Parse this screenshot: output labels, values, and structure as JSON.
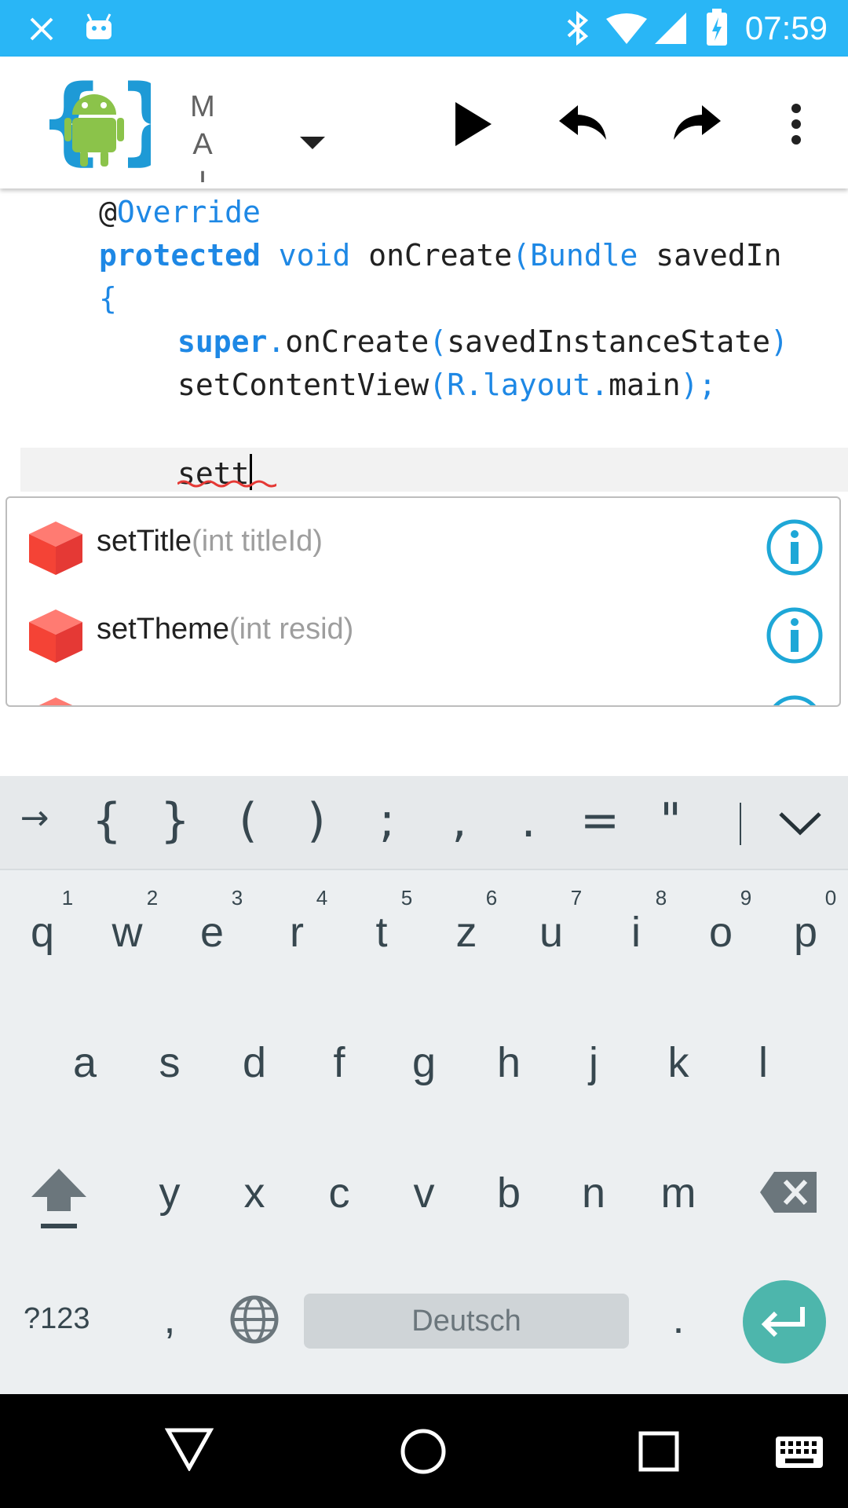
{
  "status_bar": {
    "time": "07:59"
  },
  "app_bar": {
    "title_letters": [
      "M",
      "A",
      "I"
    ],
    "icons": [
      "app-logo-icon",
      "dropdown-icon",
      "run-icon",
      "undo-icon",
      "redo-icon",
      "overflow-menu-icon"
    ]
  },
  "editor": {
    "lines": {
      "annotation_at": "@",
      "annotation_name": "Override",
      "l2_protected": "protected",
      "l2_void": "void",
      "l2_method": "onCreate",
      "l2_open": "(",
      "l2_type": "Bundle",
      "l2_param": "savedIn",
      "l3_brace": "{",
      "l4_super": "super",
      "l4_dot": ".",
      "l4_call": "onCreate",
      "l4_open": "(",
      "l4_arg": "savedInstanceState",
      "l4_close": ")",
      "l5_call": "setContentView",
      "l5_open": "(",
      "l5_r": "R",
      "l5_dot1": ".",
      "l5_layout": "layout",
      "l5_dot2": ".",
      "l5_main": "main",
      "l5_close": ");",
      "current": "sett"
    }
  },
  "suggestions": [
    {
      "name": "setTitle",
      "args": "(int titleId)"
    },
    {
      "name": "setTheme",
      "args": "(int resid)"
    }
  ],
  "symbol_row": {
    "tab": "→",
    "keys": [
      "{",
      "}",
      "(",
      ")",
      ";",
      ",",
      ".",
      "=",
      "\""
    ]
  },
  "keyboard": {
    "row1": [
      "q",
      "w",
      "e",
      "r",
      "t",
      "z",
      "u",
      "i",
      "o",
      "p"
    ],
    "row1_hints": [
      "1",
      "2",
      "3",
      "4",
      "5",
      "6",
      "7",
      "8",
      "9",
      "0"
    ],
    "row2": [
      "a",
      "s",
      "d",
      "f",
      "g",
      "h",
      "j",
      "k",
      "l"
    ],
    "row3": [
      "y",
      "x",
      "c",
      "v",
      "b",
      "n",
      "m"
    ],
    "mode_key": "?123",
    "comma": ",",
    "period": ".",
    "space_label": "Deutsch"
  },
  "colors": {
    "status_bar": "#29b6f6",
    "keyword": "#1e88e5",
    "suggestion_icon": "#f44336",
    "info_icon": "#1ea7d7",
    "enter_key": "#4db6ac"
  }
}
